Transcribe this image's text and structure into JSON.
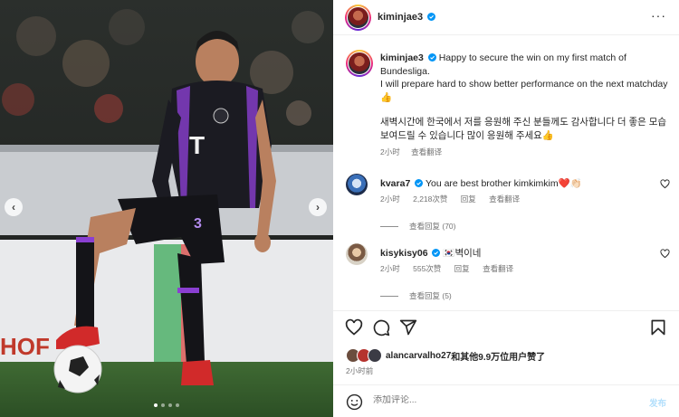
{
  "post": {
    "username": "kiminjae3",
    "more_icon": "more-horizontal-icon",
    "caption": {
      "username": "kiminjae3",
      "text_line1": "Happy to secure the win on my first match of Bundesliga.",
      "text_line2": "I will prepare hard to show better performance on the next matchday👍",
      "text_korean": "새벽시간에 한국에서 저를 응원해 주신 분들께도 감사합니다 더 좋은 모습 보여드릴 수 있습니다 많이 응원해 주세요👍",
      "time": "2小时",
      "translate": "查看翻译"
    },
    "comments": [
      {
        "username": "kvara7",
        "text": "You are best brother kimkimkim❤️👏🏻",
        "time": "2小时",
        "likes": "2,218次赞",
        "reply": "回复",
        "translate": "查看翻译",
        "view_replies": "查看回复 (70)"
      },
      {
        "username": "kisykisy06",
        "text": "🇰🇷벽이네",
        "time": "2小时",
        "likes": "555次赞",
        "reply": "回复",
        "translate": "查看翻译",
        "view_replies": "查看回复 (5)"
      }
    ],
    "likes_user": "alancarvalho27",
    "likes_text": "和其他9.9万位用户赞了",
    "time_ago": "2小时前",
    "comment_placeholder": "添加评论...",
    "post_button": "发布"
  },
  "media": {
    "jersey_number": "3",
    "slide_count": 4,
    "active_slide": 1
  },
  "colors": {
    "verified": "#0095f6",
    "text_secondary": "#737373",
    "post_button_disabled": "#b2dffc",
    "jersey": "#1b1b22",
    "jersey_accent": "#8a3fd1"
  }
}
